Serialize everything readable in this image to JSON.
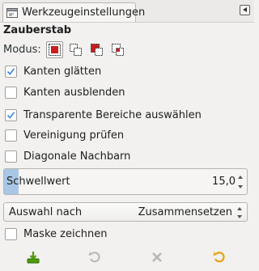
{
  "tab": {
    "label": "Werkzeugeinstellungen",
    "icon": "tool-options-icon"
  },
  "tool": {
    "title": "Zauberstab"
  },
  "mode": {
    "label": "Modus:",
    "buttons": [
      {
        "icon": "replace-selection-icon",
        "active": true
      },
      {
        "icon": "add-selection-icon",
        "active": false
      },
      {
        "icon": "subtract-selection-icon",
        "active": false
      },
      {
        "icon": "intersect-selection-icon",
        "active": false
      }
    ]
  },
  "options": [
    {
      "label": "Kanten glätten",
      "checked": true
    },
    {
      "label": "Kanten ausblenden",
      "checked": false
    },
    {
      "label": "Transparente Bereiche auswählen",
      "checked": true
    },
    {
      "label": "Vereinigung prüfen",
      "checked": false
    },
    {
      "label": "Diagonale Nachbarn",
      "checked": false
    }
  ],
  "threshold": {
    "label": "Schwellwert",
    "value": "15,0",
    "fraction": 0.059
  },
  "select_by": {
    "label": "Auswahl nach",
    "value": "Zusammensetzen"
  },
  "draw_mask": {
    "label": "Maske zeichnen",
    "checked": false
  },
  "footer": {
    "buttons": [
      {
        "icon": "save-options-icon",
        "enabled": true
      },
      {
        "icon": "restore-options-icon",
        "enabled": false
      },
      {
        "icon": "delete-options-icon",
        "enabled": false
      },
      {
        "icon": "reset-options-icon",
        "enabled": true
      }
    ]
  },
  "colors": {
    "accent": "#3584e4",
    "selection_red": "#cc1c1c",
    "threshold_fill": "#a8c7e6",
    "reset_orange": "#e8a317"
  }
}
